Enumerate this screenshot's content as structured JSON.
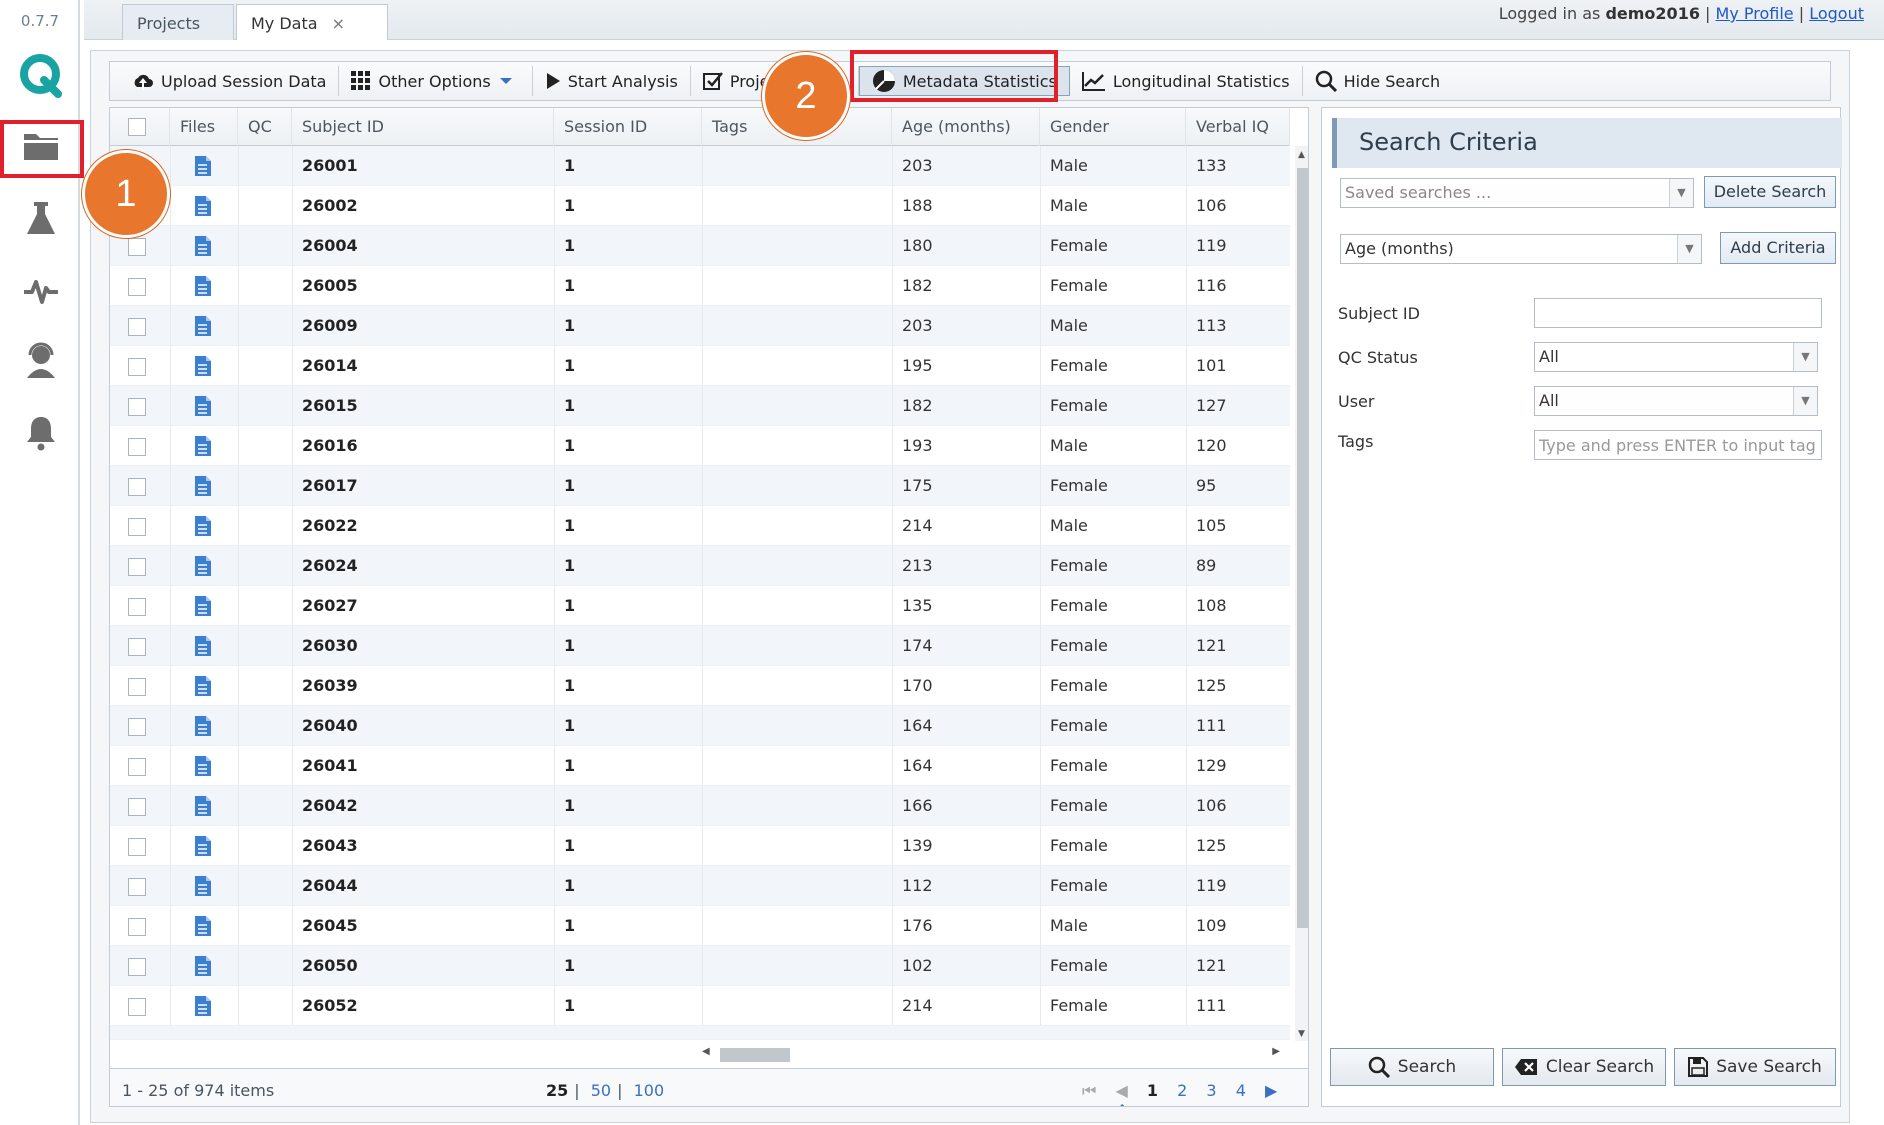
{
  "app": {
    "version": "0.7.7"
  },
  "tabs": [
    {
      "label": "Projects"
    },
    {
      "label": "My Data",
      "close": "×"
    }
  ],
  "login": {
    "prefix": "Logged in as",
    "user": "demo2016",
    "sep": "|",
    "profile": "My Profile",
    "logout": "Logout"
  },
  "toolbar": {
    "upload": "Upload Session Data",
    "other": "Other Options",
    "analysis": "Start Analysis",
    "project": "Projec",
    "metadata": "Metadata Statistics",
    "longitudinal": "Longitudinal Statistics",
    "hide": "Hide Search"
  },
  "grid": {
    "headers": {
      "files": "Files",
      "qc": "QC",
      "subject": "Subject ID",
      "session": "Session ID",
      "tags": "Tags",
      "age": "Age (months)",
      "gender": "Gender",
      "viq": "Verbal IQ"
    },
    "rows": [
      {
        "subject": "26001",
        "session": "1",
        "age": "203",
        "gender": "Male",
        "viq": "133"
      },
      {
        "subject": "26002",
        "session": "1",
        "age": "188",
        "gender": "Male",
        "viq": "106"
      },
      {
        "subject": "26004",
        "session": "1",
        "age": "180",
        "gender": "Female",
        "viq": "119"
      },
      {
        "subject": "26005",
        "session": "1",
        "age": "182",
        "gender": "Female",
        "viq": "116"
      },
      {
        "subject": "26009",
        "session": "1",
        "age": "203",
        "gender": "Male",
        "viq": "113"
      },
      {
        "subject": "26014",
        "session": "1",
        "age": "195",
        "gender": "Female",
        "viq": "101"
      },
      {
        "subject": "26015",
        "session": "1",
        "age": "182",
        "gender": "Female",
        "viq": "127"
      },
      {
        "subject": "26016",
        "session": "1",
        "age": "193",
        "gender": "Male",
        "viq": "120"
      },
      {
        "subject": "26017",
        "session": "1",
        "age": "175",
        "gender": "Female",
        "viq": "95"
      },
      {
        "subject": "26022",
        "session": "1",
        "age": "214",
        "gender": "Male",
        "viq": "105"
      },
      {
        "subject": "26024",
        "session": "1",
        "age": "213",
        "gender": "Female",
        "viq": "89"
      },
      {
        "subject": "26027",
        "session": "1",
        "age": "135",
        "gender": "Female",
        "viq": "108"
      },
      {
        "subject": "26030",
        "session": "1",
        "age": "174",
        "gender": "Female",
        "viq": "121"
      },
      {
        "subject": "26039",
        "session": "1",
        "age": "170",
        "gender": "Female",
        "viq": "125"
      },
      {
        "subject": "26040",
        "session": "1",
        "age": "164",
        "gender": "Female",
        "viq": "111"
      },
      {
        "subject": "26041",
        "session": "1",
        "age": "164",
        "gender": "Female",
        "viq": "129"
      },
      {
        "subject": "26042",
        "session": "1",
        "age": "166",
        "gender": "Female",
        "viq": "106"
      },
      {
        "subject": "26043",
        "session": "1",
        "age": "139",
        "gender": "Female",
        "viq": "125"
      },
      {
        "subject": "26044",
        "session": "1",
        "age": "112",
        "gender": "Female",
        "viq": "119"
      },
      {
        "subject": "26045",
        "session": "1",
        "age": "176",
        "gender": "Male",
        "viq": "109"
      },
      {
        "subject": "26050",
        "session": "1",
        "age": "102",
        "gender": "Female",
        "viq": "121"
      },
      {
        "subject": "26052",
        "session": "1",
        "age": "214",
        "gender": "Female",
        "viq": "111"
      }
    ]
  },
  "pager": {
    "info": "1 - 25 of 974 items",
    "sizes": [
      "25",
      "50",
      "100"
    ],
    "pages": [
      "1",
      "2",
      "3",
      "4"
    ]
  },
  "search": {
    "title": "Search Criteria",
    "saved_placeholder": "Saved searches ...",
    "delete": "Delete Search",
    "criteria_value": "Age (months)",
    "add": "Add Criteria",
    "subject_label": "Subject ID",
    "qc_label": "QC Status",
    "qc_value": "All",
    "user_label": "User",
    "user_value": "All",
    "tags_label": "Tags",
    "tags_placeholder": "Type and press ENTER to input tag",
    "search_btn": "Search",
    "clear_btn": "Clear Search",
    "save_btn": "Save Search"
  },
  "annotations": {
    "one": "1",
    "two": "2"
  },
  "colors": {
    "accent": "#e8762d",
    "highlight": "#e0202a",
    "link": "#1f58c7",
    "icon_blue": "#3b7fd1",
    "logo_teal": "#1aa3a3"
  }
}
